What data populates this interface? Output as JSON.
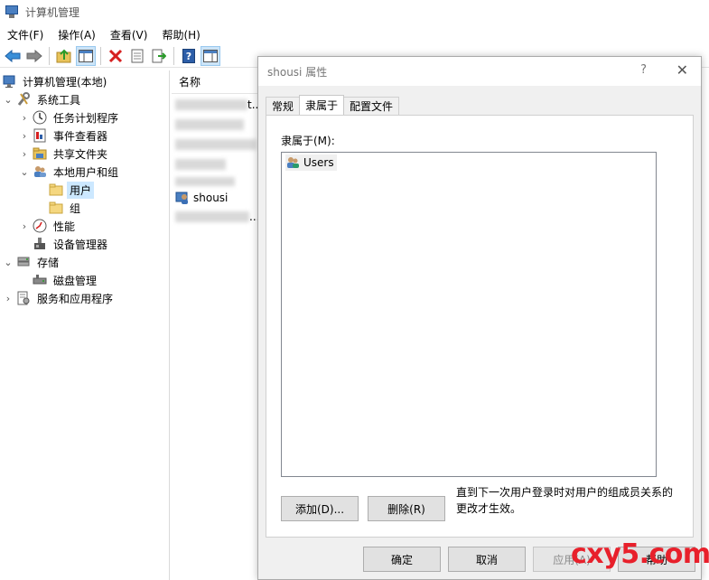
{
  "window": {
    "title": "计算机管理"
  },
  "menu": [
    "文件(F)",
    "操作(A)",
    "查看(V)",
    "帮助(H)"
  ],
  "toolbar_icons": [
    "back-arrow-icon",
    "forward-arrow-icon",
    "up-folder-icon",
    "show-hide-tree-icon",
    "delete-icon",
    "properties-icon",
    "export-icon",
    "help-icon",
    "action-pane-icon"
  ],
  "tree": {
    "root": "计算机管理(本地)",
    "system_tools": "系统工具",
    "task_scheduler": "任务计划程序",
    "event_viewer": "事件查看器",
    "shared_folders": "共享文件夹",
    "local_users_groups": "本地用户和组",
    "users": "用户",
    "groups": "组",
    "performance": "性能",
    "device_manager": "设备管理器",
    "storage": "存储",
    "disk_management": "磁盘管理",
    "services_apps": "服务和应用程序"
  },
  "list": {
    "column_name": "名称",
    "visible_user": "shousi",
    "trunc_1": "t...",
    "trunc_2": "..."
  },
  "dialog": {
    "title": "shousi 属性",
    "help_glyph": "?",
    "close_glyph": "✕",
    "tabs": [
      "常规",
      "隶属于",
      "配置文件"
    ],
    "active_tab": "隶属于",
    "member_of_label": "隶属于(M):",
    "members": [
      "Users"
    ],
    "add_button": "添加(D)...",
    "remove_button": "删除(R)",
    "note": "直到下一次用户登录时对用户的组成员关系的更改才生效。",
    "ok_button": "确定",
    "cancel_button": "取消",
    "apply_button": "应用(A)",
    "help_button": "帮助"
  },
  "watermark": "cxy5.com"
}
